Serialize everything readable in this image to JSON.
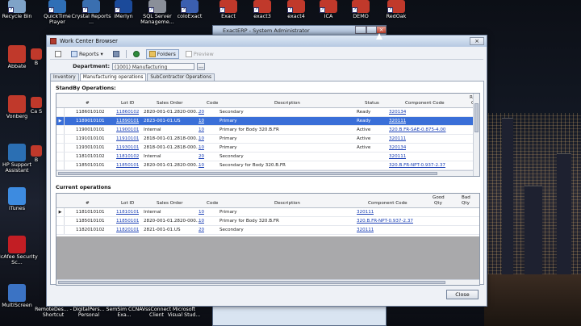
{
  "desktop": {
    "top_icons": [
      {
        "label": "Recycle Bin",
        "name": "recycle-bin-icon",
        "color": "#7fa3c8"
      },
      {
        "label": "QuickTime Player",
        "name": "quicktime-icon",
        "color": "#2f6fb6"
      },
      {
        "label": "Crystal Reports ...",
        "name": "crystal-reports-icon",
        "color": "#3a6fb0"
      },
      {
        "label": "iMerlyn",
        "name": "imerlyn-icon",
        "color": "#1b4a9a"
      },
      {
        "label": "SQL Server Manageme...",
        "name": "sql-server-icon",
        "color": "#8a8f99"
      },
      {
        "label": "coloExact",
        "name": "coloexact-icon",
        "color": "#3b5fb0"
      },
      {
        "label": "Exact",
        "name": "exact-icon",
        "color": "#c0392b"
      },
      {
        "label": "exact3",
        "name": "exact3-icon",
        "color": "#c0392b"
      },
      {
        "label": "exact4",
        "name": "exact4-icon",
        "color": "#c0392b"
      },
      {
        "label": "ICA",
        "name": "ica-icon",
        "color": "#c0392b"
      },
      {
        "label": "DEMO",
        "name": "demo-icon",
        "color": "#c0392b"
      },
      {
        "label": "RedOak",
        "name": "redoak-icon",
        "color": "#c0392b"
      }
    ],
    "left_icons": [
      {
        "label": "Abbate",
        "name": "abbate-icon",
        "color": "#c0392b"
      },
      {
        "label": "Vonberg",
        "name": "vonberg-icon",
        "color": "#c0392b"
      },
      {
        "label": "HP Support Assistant",
        "name": "hp-support-icon",
        "color": "#2b6fb3"
      },
      {
        "label": "iTunes",
        "name": "itunes-icon",
        "color": "#3d8be0"
      },
      {
        "label": "McAfee Security Sc...",
        "name": "mcafee-icon",
        "color": "#c21e24"
      },
      {
        "label": "MultiScreen",
        "name": "multiscreen-icon",
        "color": "#3b73c4"
      }
    ],
    "partial_left_labels": [
      "B",
      "Ca S",
      "B"
    ],
    "bottom_icons": [
      {
        "label": "RemoteDes... - Shortcut",
        "name": "remote-desktop-icon"
      },
      {
        "label": "DigitalPers... Personal",
        "name": "digitalpersona-icon"
      },
      {
        "label": "SemSim CCNA Exa...",
        "name": "semsim-icon"
      },
      {
        "label": "VssConnect Client",
        "name": "vssconnect-icon"
      },
      {
        "label": "Microsoft Visual Stud...",
        "name": "visual-studio-icon"
      }
    ]
  },
  "background_window": {
    "title": "ExactERP - System Administrator"
  },
  "window": {
    "title": "Work Center Browser",
    "close_glyph": "×",
    "toolbar": {
      "reports_label": "Reports",
      "reports_arrow": "▾",
      "folders_label": "Folders",
      "preview_label": "Preview"
    },
    "department": {
      "label": "Department:",
      "value": "(1001) Manufacturing",
      "browse": "..."
    },
    "tabs": [
      "Inventory",
      "Manufacturing operations",
      "SubContractor Operations"
    ],
    "active_tab": 1,
    "standby": {
      "title": "StandBy Operations:",
      "columns": {
        "num": "#",
        "lot": "Lot ID",
        "so": "Sales Order",
        "code": "Code",
        "desc": "Description",
        "status": "Status",
        "comp": "Component Code",
        "extra_top": "Re",
        "extra_bottom": "Q"
      },
      "rows": [
        {
          "num": "1186010102",
          "lot": "11860102",
          "so": "2820-001-01.2820-000...",
          "code": "20",
          "desc": "Secondary",
          "status": "Ready",
          "comp": "320134",
          "selected": false
        },
        {
          "num": "1189010101",
          "lot": "11890101",
          "so": "2823-001-01.US",
          "code": "10",
          "desc": "Primary",
          "status": "Ready",
          "comp": "320111",
          "selected": true
        },
        {
          "num": "1190010101",
          "lot": "11900101",
          "so": "Internal",
          "code": "10",
          "desc": "Primary for Body 320.B.FR",
          "status": "Active",
          "comp": "320.B.FR-SAE-0.875-4.00",
          "selected": false
        },
        {
          "num": "1191010101",
          "lot": "11910101",
          "so": "2818-001-01.2818-000...",
          "code": "10",
          "desc": "Primary",
          "status": "Active",
          "comp": "320111",
          "selected": false
        },
        {
          "num": "1193010101",
          "lot": "11930101",
          "so": "2818-001-01.2818-000...",
          "code": "10",
          "desc": "Primary",
          "status": "Active",
          "comp": "320134",
          "selected": false
        },
        {
          "num": "1181010102",
          "lot": "11810102",
          "so": "Internal",
          "code": "20",
          "desc": "Secondary",
          "status": "",
          "comp": "320111",
          "selected": false
        },
        {
          "num": "1185010101",
          "lot": "11850101",
          "so": "2820-001-01.2820-000...",
          "code": "10",
          "desc": "Secondary for Body 320.B.FR",
          "status": "",
          "comp": "320.B.FR-NPT-0.937-2.37",
          "selected": false
        }
      ],
      "row_marker": "▶"
    },
    "current": {
      "title": "Current operations",
      "columns": {
        "num": "#",
        "lot": "Lot ID",
        "so": "Sales Order",
        "code": "Code",
        "desc": "Description",
        "comp": "Component Code",
        "good_top": "Good",
        "good_bottom": "Qty",
        "bad_top": "Bad",
        "bad_bottom": "Qty"
      },
      "rows": [
        {
          "num": "1181010101",
          "lot": "11810101",
          "so": "Internal",
          "code": "10",
          "desc": "Primary",
          "comp": "320111"
        },
        {
          "num": "1185010101",
          "lot": "11850101",
          "so": "2820-001-01.2820-000...",
          "code": "10",
          "desc": "Primary for Body 320.B.FR",
          "comp": "320.B.FR-NPT-0.937-2.37"
        },
        {
          "num": "1182010102",
          "lot": "11820101",
          "so": "2821-001-01.US",
          "code": "20",
          "desc": "Secondary",
          "comp": "320111"
        }
      ],
      "row_marker": "▶"
    },
    "close_label": "Close"
  }
}
